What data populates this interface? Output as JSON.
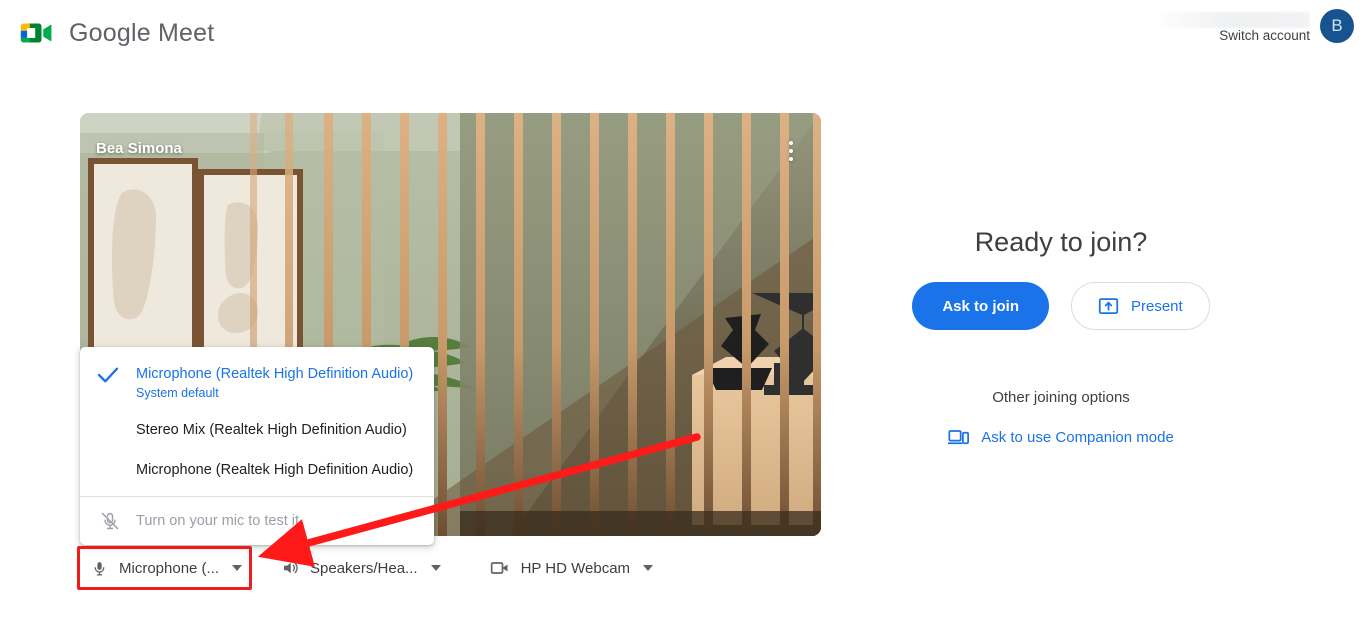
{
  "header": {
    "brand_name": "Google Meet",
    "logo_icon": "google-meet-logo",
    "account": {
      "email_redacted": "",
      "switch_label": "Switch account",
      "avatar_initial": "B",
      "avatar_color": "#17548f"
    }
  },
  "preview": {
    "participant_name": "Bea Simona",
    "more_options_icon": "more-vertical-icon",
    "framing_button_icon": "auto-framing-icon",
    "effects_button_icon": "sparkle-effects-icon"
  },
  "device_bar": {
    "microphone": {
      "icon": "microphone-icon",
      "label": "Microphone (...",
      "caret": "chevron-down-icon"
    },
    "speakers": {
      "icon": "speaker-icon",
      "label": "Speakers/Hea...",
      "caret": "chevron-down-icon"
    },
    "camera": {
      "icon": "video-camera-icon",
      "label": "HP HD Webcam",
      "caret": "chevron-down-icon"
    }
  },
  "microphone_dropdown": {
    "options": [
      {
        "label": "Microphone (Realtek High Definition Audio)",
        "sublabel": "System default",
        "selected": true,
        "check_icon": "checkmark-icon"
      },
      {
        "label": "Stereo Mix (Realtek High Definition Audio)",
        "sublabel": "",
        "selected": false,
        "check_icon": ""
      },
      {
        "label": "Microphone (Realtek High Definition Audio)",
        "sublabel": "",
        "selected": false,
        "check_icon": ""
      }
    ],
    "test_row": {
      "icon": "mic-off-icon",
      "label": "Turn on your mic to test it"
    }
  },
  "right_panel": {
    "title": "Ready to join?",
    "ask_to_join_label": "Ask to join",
    "present_label": "Present",
    "present_icon": "present-screen-icon",
    "other_options_label": "Other joining options",
    "companion_label": "Ask to use Companion mode",
    "companion_icon": "companion-devices-icon"
  },
  "annotations": {
    "highlight_box_color": "#ee1c1c",
    "arrow_color": "#ff1a1a",
    "arrow_target": "microphone-device-button"
  },
  "colors": {
    "accent_blue": "#1a73e8",
    "text_primary": "#3c4043",
    "text_secondary": "#5f6368",
    "muted": "#9aa0a6"
  }
}
